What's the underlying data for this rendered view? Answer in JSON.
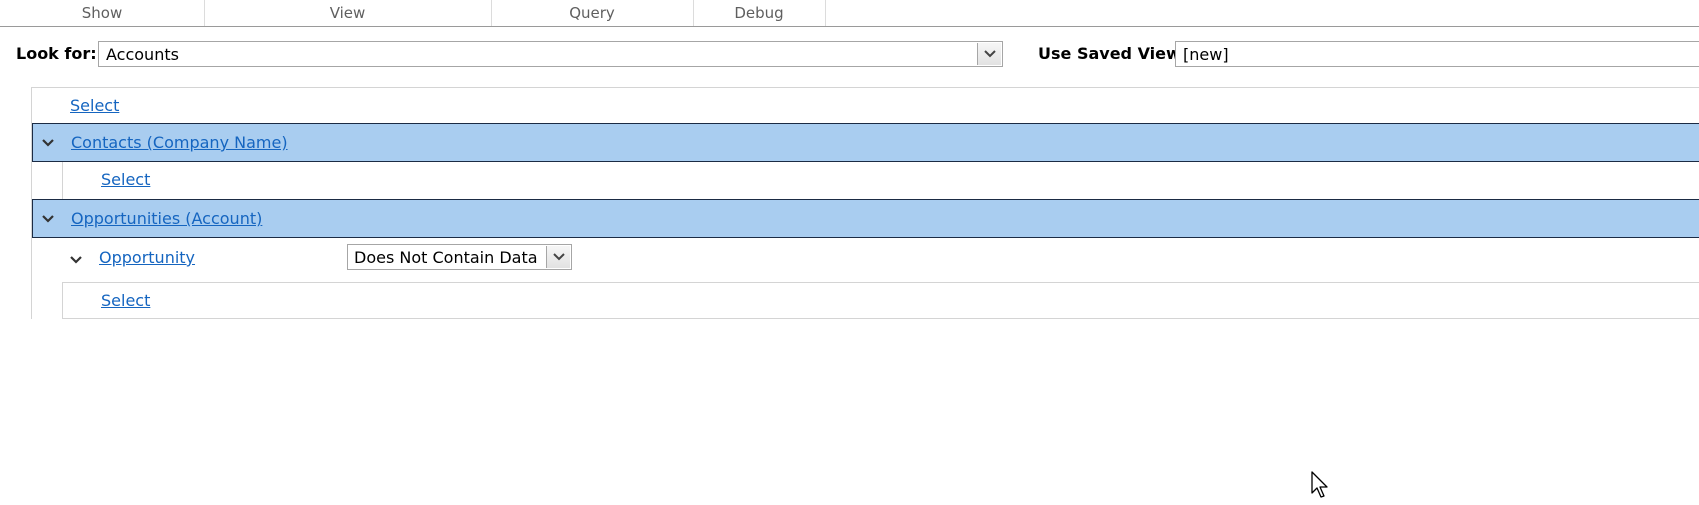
{
  "ribbon": {
    "groups": [
      "Show",
      "View",
      "Query",
      "Debug"
    ]
  },
  "lookfor": {
    "label": "Look for:",
    "value": "Accounts"
  },
  "saved_view": {
    "label": "Use Saved View:",
    "value": "[new]"
  },
  "tree": {
    "top_select": "Select",
    "relationships": [
      {
        "label": "Contacts (Company Name)",
        "select": "Select"
      },
      {
        "label": "Opportunities (Account)",
        "condition": {
          "field": "Opportunity",
          "operator": "Does Not Contain Data"
        },
        "select": "Select"
      }
    ]
  },
  "icons": {
    "dropdown": "chevron-down-icon",
    "expand": "collapse-chevron-icon",
    "cursor": "mouse-pointer-icon"
  },
  "colors": {
    "link": "#1565c0",
    "selected_row": "#a9cdf0",
    "selected_border": "#1b2b44"
  }
}
